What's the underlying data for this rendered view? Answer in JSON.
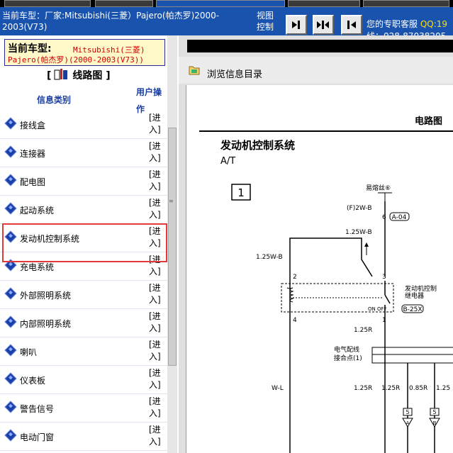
{
  "header": {
    "car_title": "当前车型：厂家:Mitsubishi(三菱）Pajero(帕杰罗)2000-2003(V73)",
    "view_label": "视图控制",
    "service_label": "您的专职客服",
    "qq_label": "QQ:19",
    "phone_label": "线：028-87038205"
  },
  "left": {
    "car_label": "当前车型:",
    "car_brand": "Mitsubishi(三菱)",
    "car_model": "Pajero(帕杰罗)(2000-2003(V73))",
    "section_title": "线路图",
    "col_category": "信息类别",
    "col_operation": "用户操作",
    "enter_label": "[进入]",
    "items": [
      {
        "label": "接线盒"
      },
      {
        "label": "连接器"
      },
      {
        "label": "配电图"
      },
      {
        "label": "起动系统"
      },
      {
        "label": "发动机控制系统"
      },
      {
        "label": "充电系统"
      },
      {
        "label": "外部照明系统"
      },
      {
        "label": "内部照明系统"
      },
      {
        "label": "喇叭"
      },
      {
        "label": "仪表板"
      },
      {
        "label": "警告信号"
      },
      {
        "label": "电动门窗"
      }
    ]
  },
  "right": {
    "browse_label": "浏览信息目录",
    "page_header": "电路图",
    "system_title": "发动机控制系统",
    "at_label": "A/T",
    "diagram": {
      "box_number": "1",
      "fuse": "易熔丝⑥",
      "wire_f": "(F)2W-B",
      "pin6": "6",
      "conn_a04": "A-04",
      "w125wb_a": "1.25W-B",
      "w125wb_b": "1.25W-B",
      "pin2": "2",
      "pin3": "3",
      "pin4": "4",
      "pin1": "1",
      "relay_line1": "发动机控制",
      "relay_line2": "继电器",
      "on_off": "ON  OFF",
      "conn_b25x": "B-25X",
      "w125r": "1.25R",
      "junction_line1": "电气配线",
      "junction_line2": "接合点(1)",
      "wl": "W-L",
      "bottom1": "1.25R",
      "bottom2": "1.25R",
      "bottom3": "0.85R",
      "bottom4": "1.25",
      "n5a": "5",
      "n5b": "5",
      "ga": "A",
      "gb": "B"
    }
  }
}
